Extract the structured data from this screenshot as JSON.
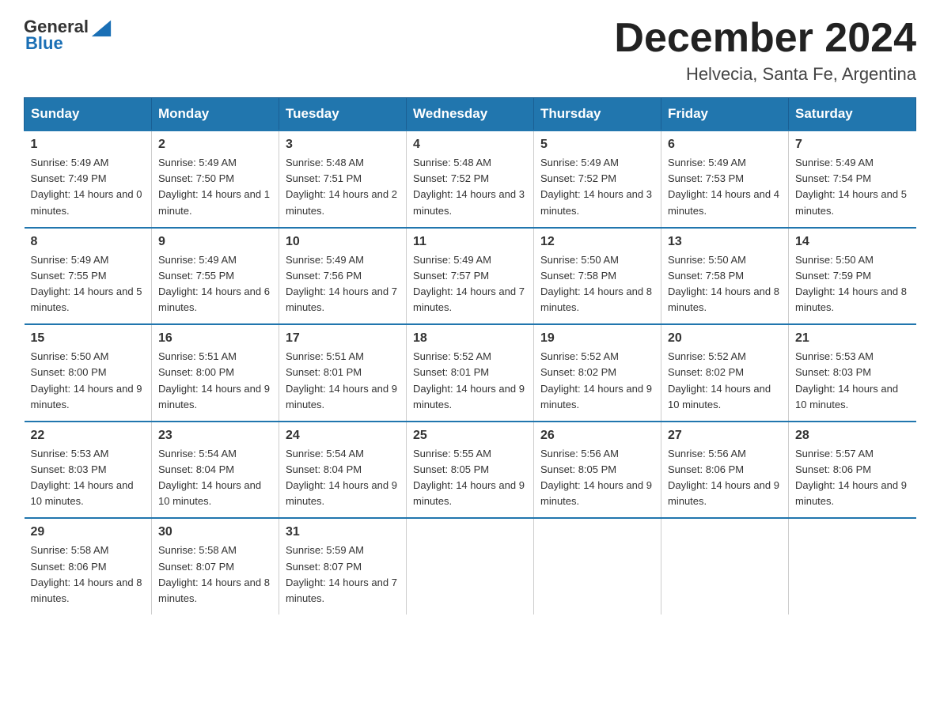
{
  "header": {
    "logo_general": "General",
    "logo_blue": "Blue",
    "month_title": "December 2024",
    "subtitle": "Helvecia, Santa Fe, Argentina"
  },
  "days_of_week": [
    "Sunday",
    "Monday",
    "Tuesday",
    "Wednesday",
    "Thursday",
    "Friday",
    "Saturday"
  ],
  "weeks": [
    [
      {
        "day": "1",
        "sunrise": "5:49 AM",
        "sunset": "7:49 PM",
        "daylight": "14 hours and 0 minutes."
      },
      {
        "day": "2",
        "sunrise": "5:49 AM",
        "sunset": "7:50 PM",
        "daylight": "14 hours and 1 minute."
      },
      {
        "day": "3",
        "sunrise": "5:48 AM",
        "sunset": "7:51 PM",
        "daylight": "14 hours and 2 minutes."
      },
      {
        "day": "4",
        "sunrise": "5:48 AM",
        "sunset": "7:52 PM",
        "daylight": "14 hours and 3 minutes."
      },
      {
        "day": "5",
        "sunrise": "5:49 AM",
        "sunset": "7:52 PM",
        "daylight": "14 hours and 3 minutes."
      },
      {
        "day": "6",
        "sunrise": "5:49 AM",
        "sunset": "7:53 PM",
        "daylight": "14 hours and 4 minutes."
      },
      {
        "day": "7",
        "sunrise": "5:49 AM",
        "sunset": "7:54 PM",
        "daylight": "14 hours and 5 minutes."
      }
    ],
    [
      {
        "day": "8",
        "sunrise": "5:49 AM",
        "sunset": "7:55 PM",
        "daylight": "14 hours and 5 minutes."
      },
      {
        "day": "9",
        "sunrise": "5:49 AM",
        "sunset": "7:55 PM",
        "daylight": "14 hours and 6 minutes."
      },
      {
        "day": "10",
        "sunrise": "5:49 AM",
        "sunset": "7:56 PM",
        "daylight": "14 hours and 7 minutes."
      },
      {
        "day": "11",
        "sunrise": "5:49 AM",
        "sunset": "7:57 PM",
        "daylight": "14 hours and 7 minutes."
      },
      {
        "day": "12",
        "sunrise": "5:50 AM",
        "sunset": "7:58 PM",
        "daylight": "14 hours and 8 minutes."
      },
      {
        "day": "13",
        "sunrise": "5:50 AM",
        "sunset": "7:58 PM",
        "daylight": "14 hours and 8 minutes."
      },
      {
        "day": "14",
        "sunrise": "5:50 AM",
        "sunset": "7:59 PM",
        "daylight": "14 hours and 8 minutes."
      }
    ],
    [
      {
        "day": "15",
        "sunrise": "5:50 AM",
        "sunset": "8:00 PM",
        "daylight": "14 hours and 9 minutes."
      },
      {
        "day": "16",
        "sunrise": "5:51 AM",
        "sunset": "8:00 PM",
        "daylight": "14 hours and 9 minutes."
      },
      {
        "day": "17",
        "sunrise": "5:51 AM",
        "sunset": "8:01 PM",
        "daylight": "14 hours and 9 minutes."
      },
      {
        "day": "18",
        "sunrise": "5:52 AM",
        "sunset": "8:01 PM",
        "daylight": "14 hours and 9 minutes."
      },
      {
        "day": "19",
        "sunrise": "5:52 AM",
        "sunset": "8:02 PM",
        "daylight": "14 hours and 9 minutes."
      },
      {
        "day": "20",
        "sunrise": "5:52 AM",
        "sunset": "8:02 PM",
        "daylight": "14 hours and 10 minutes."
      },
      {
        "day": "21",
        "sunrise": "5:53 AM",
        "sunset": "8:03 PM",
        "daylight": "14 hours and 10 minutes."
      }
    ],
    [
      {
        "day": "22",
        "sunrise": "5:53 AM",
        "sunset": "8:03 PM",
        "daylight": "14 hours and 10 minutes."
      },
      {
        "day": "23",
        "sunrise": "5:54 AM",
        "sunset": "8:04 PM",
        "daylight": "14 hours and 10 minutes."
      },
      {
        "day": "24",
        "sunrise": "5:54 AM",
        "sunset": "8:04 PM",
        "daylight": "14 hours and 9 minutes."
      },
      {
        "day": "25",
        "sunrise": "5:55 AM",
        "sunset": "8:05 PM",
        "daylight": "14 hours and 9 minutes."
      },
      {
        "day": "26",
        "sunrise": "5:56 AM",
        "sunset": "8:05 PM",
        "daylight": "14 hours and 9 minutes."
      },
      {
        "day": "27",
        "sunrise": "5:56 AM",
        "sunset": "8:06 PM",
        "daylight": "14 hours and 9 minutes."
      },
      {
        "day": "28",
        "sunrise": "5:57 AM",
        "sunset": "8:06 PM",
        "daylight": "14 hours and 9 minutes."
      }
    ],
    [
      {
        "day": "29",
        "sunrise": "5:58 AM",
        "sunset": "8:06 PM",
        "daylight": "14 hours and 8 minutes."
      },
      {
        "day": "30",
        "sunrise": "5:58 AM",
        "sunset": "8:07 PM",
        "daylight": "14 hours and 8 minutes."
      },
      {
        "day": "31",
        "sunrise": "5:59 AM",
        "sunset": "8:07 PM",
        "daylight": "14 hours and 7 minutes."
      },
      null,
      null,
      null,
      null
    ]
  ]
}
